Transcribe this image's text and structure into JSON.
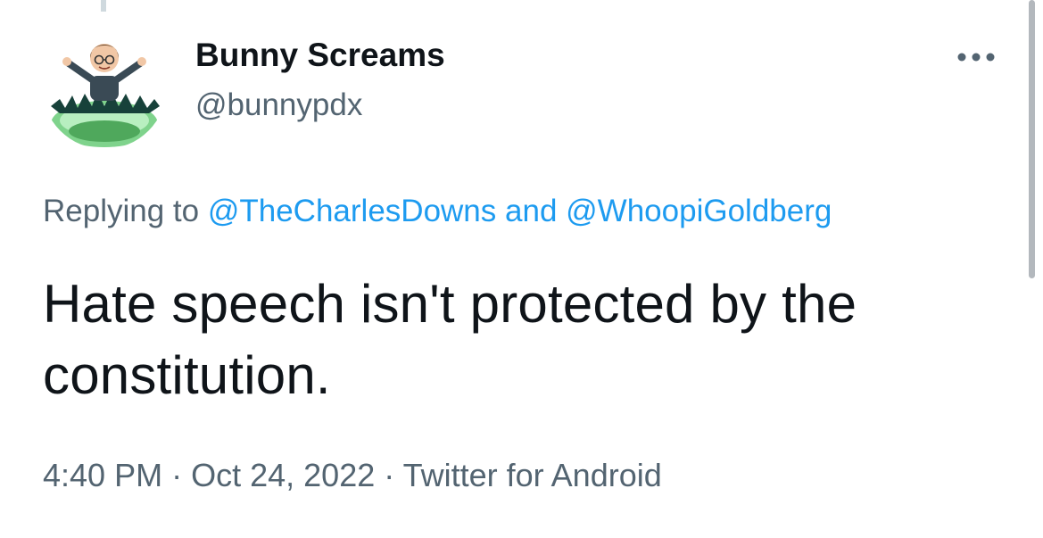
{
  "tweet": {
    "display_name": "Bunny Screams",
    "handle": "@bunnypdx",
    "avatar_icon": "bitmoji-avatar-icon",
    "more_icon": "more-horizontal-icon",
    "reply_prefix": "Replying to",
    "reply_mention_1": "@TheCharlesDowns",
    "reply_and": "and",
    "reply_mention_2": "@WhoopiGoldberg",
    "text_line_1": "Hate speech isn't protected by the",
    "text_line_2": "constitution.",
    "time": "4:40 PM",
    "separator": "·",
    "date": "Oct 24, 2022",
    "source": "Twitter for Android"
  },
  "colors": {
    "text_primary": "#0f1419",
    "text_secondary": "#536471",
    "link": "#1d9bf0",
    "avatar_green": "#6cc47a"
  }
}
